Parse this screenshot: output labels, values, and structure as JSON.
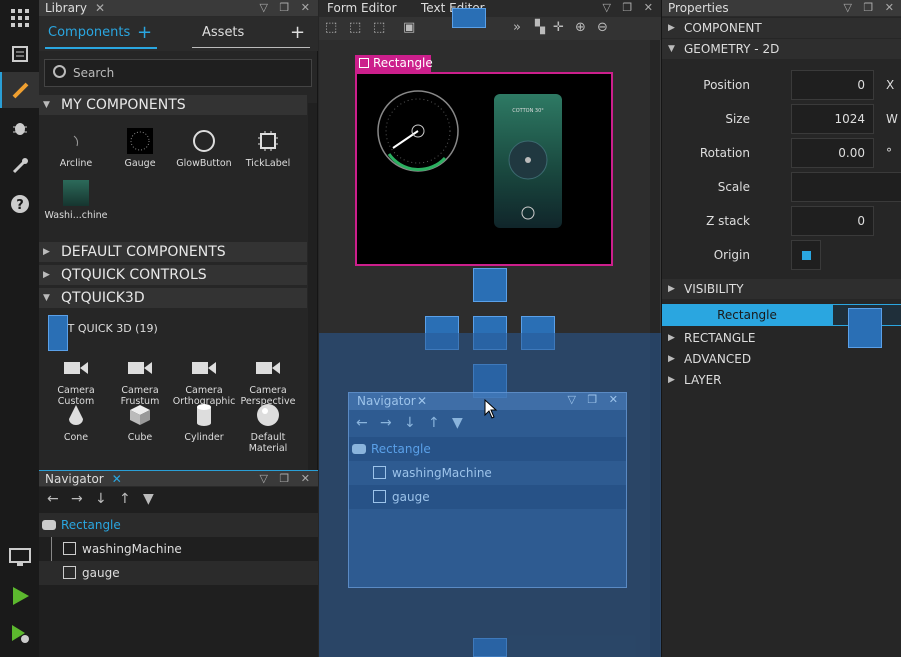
{
  "modebar": {
    "modes": [
      "welcome-icon",
      "edit-icon",
      "debug-icon",
      "projects-icon",
      "help-icon"
    ],
    "run": [
      "monitor-icon",
      "run-icon",
      "run-debug-icon"
    ]
  },
  "library": {
    "title": "Library",
    "tabs": {
      "components": "Components",
      "assets": "Assets"
    },
    "search_placeholder": "Search",
    "sections": {
      "my": "MY COMPONENTS",
      "default": "DEFAULT COMPONENTS",
      "qtquick": "QTQUICK CONTROLS",
      "q3d": "QTQUICK3D",
      "q3dsub": "QT QUICK 3D (19)"
    },
    "my_components": [
      "Arcline",
      "Gauge",
      "GlowButton",
      "TickLabel",
      "Washi...chine"
    ],
    "q3d_items": [
      "Camera Custom",
      "Camera Frustum",
      "Camera Orthographic",
      "Camera Perspective",
      "Cone",
      "Cube",
      "Cylinder",
      "Default Material"
    ]
  },
  "navigator": {
    "title": "Navigator",
    "root": "Rectangle",
    "children": [
      "washingMachine",
      "gauge"
    ]
  },
  "editor": {
    "tabs": [
      "Form Editor",
      "Text Editor"
    ],
    "selection_label": "Rectangle",
    "phone_title": "COTTON 30°"
  },
  "properties": {
    "title": "Properties",
    "sections": {
      "component": "COMPONENT",
      "geometry": "GEOMETRY - 2D",
      "visibility": "VISIBILITY",
      "rectangle": "RECTANGLE",
      "advanced": "ADVANCED",
      "layer": "LAYER"
    },
    "fields": {
      "position_label": "Position",
      "position_value": "0",
      "position_unit": "X",
      "size_label": "Size",
      "size_value": "1024",
      "size_unit": "W",
      "rotation_label": "Rotation",
      "rotation_value": "0.00",
      "rotation_unit": "°",
      "scale_label": "Scale",
      "scale_value": "",
      "zstack_label": "Z stack",
      "zstack_value": "0",
      "origin_label": "Origin"
    },
    "drag_tab": "Rectangle"
  }
}
